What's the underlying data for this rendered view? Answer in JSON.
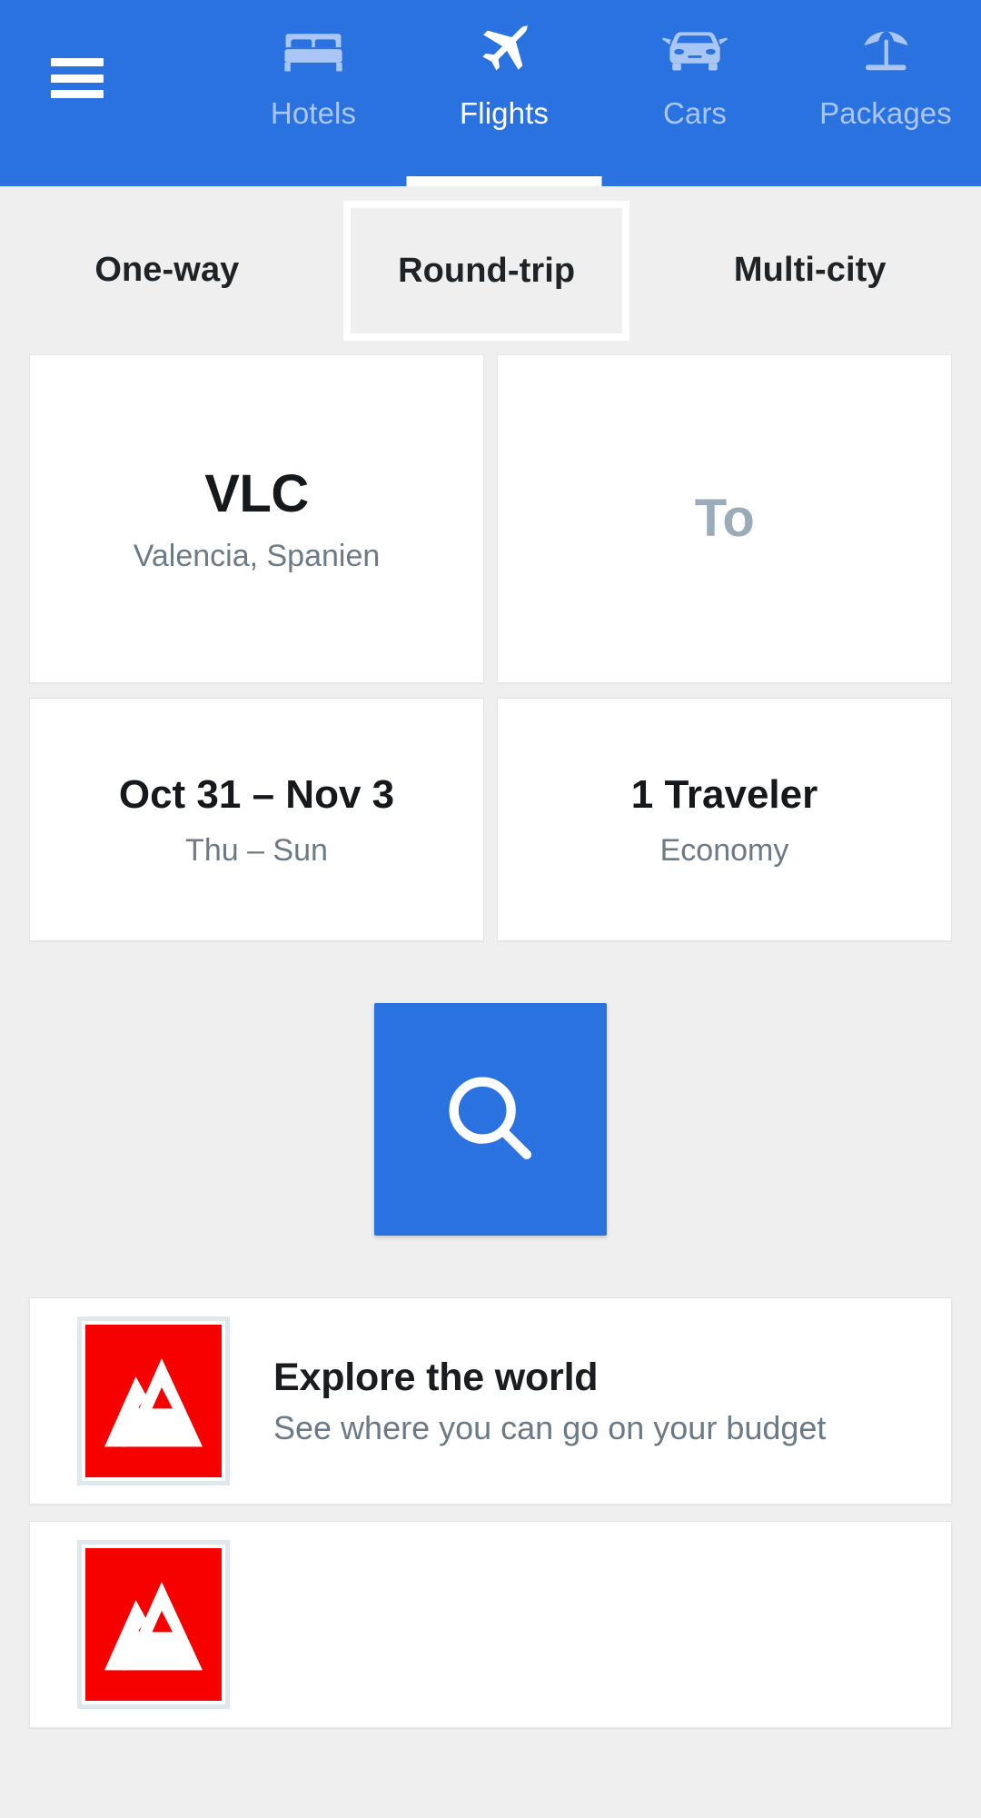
{
  "theme": {
    "brand_blue": "#2a72e0",
    "page_bg": "#efefef",
    "card_bg": "#ffffff",
    "muted_text": "#6b7a85",
    "placeholder_text": "#9aabba",
    "inactive_tab_text": "#a9c6f4",
    "thumb_red": "#f60000"
  },
  "header": {
    "menu_icon": "hamburger-menu-icon",
    "tabs": [
      {
        "label": "Hotels",
        "icon": "bed-icon",
        "active": false
      },
      {
        "label": "Flights",
        "icon": "airplane-icon",
        "active": true
      },
      {
        "label": "Cars",
        "icon": "car-icon",
        "active": false
      },
      {
        "label": "Packages",
        "icon": "beach-umbrella-icon",
        "active": false
      }
    ]
  },
  "trip_types": [
    {
      "label": "One-way",
      "selected": false
    },
    {
      "label": "Round-trip",
      "selected": true
    },
    {
      "label": "Multi-city",
      "selected": false
    }
  ],
  "search_form": {
    "origin": {
      "code": "VLC",
      "city": "Valencia, Spanien"
    },
    "destination": {
      "placeholder": "To",
      "value": ""
    },
    "dates": {
      "range": "Oct 31 – Nov 3",
      "weekdays": "Thu – Sun"
    },
    "travelers": {
      "count": "1 Traveler",
      "cabin": "Economy"
    },
    "search_button": {
      "icon": "search-magnifier-icon",
      "label": "Search"
    }
  },
  "promos": [
    {
      "title": "Explore the world",
      "subtitle": "See where you can go on your budget",
      "thumb_icon": "mountain-image-placeholder-icon"
    },
    {
      "title": "",
      "subtitle": "",
      "thumb_icon": "mountain-image-placeholder-icon"
    }
  ]
}
